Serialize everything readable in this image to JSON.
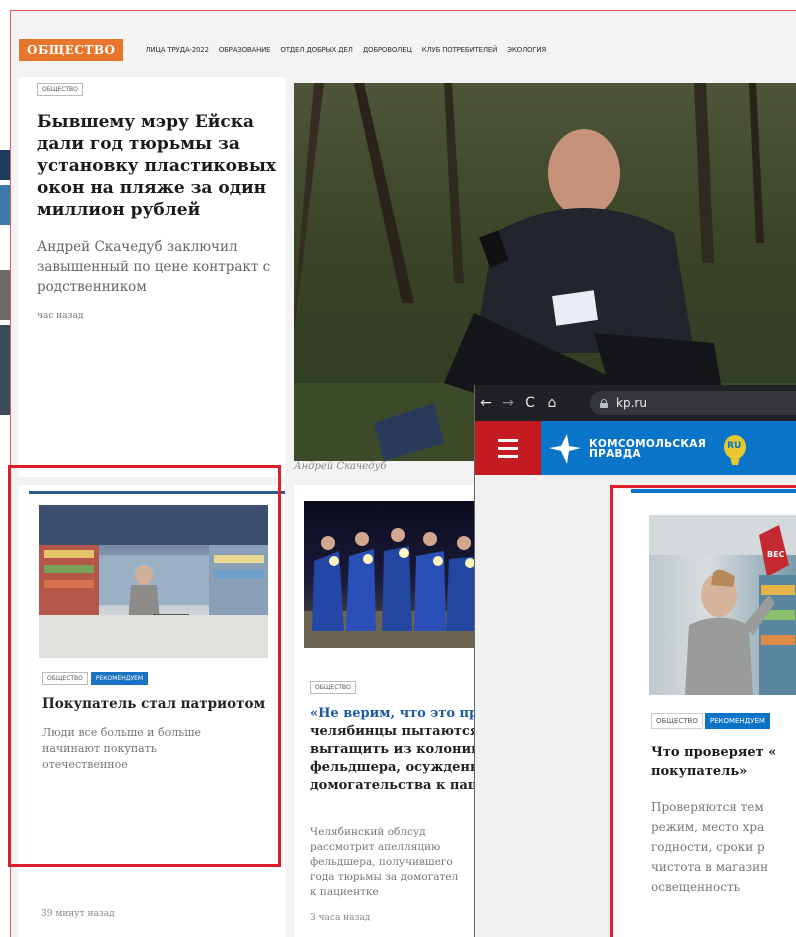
{
  "section": {
    "badge": "ОБЩЕСТВО",
    "tags": [
      "ЛИЦА ТРУДА-2022",
      "ОБРАЗОВАНИЕ",
      "ОТДЕЛ ДОБРЫХ ДЕЛ",
      "ДОБРОВОЛЕЦ",
      "КЛУБ ПОТРЕБИТЕЛЕЙ",
      "ЭКОЛОГИЯ"
    ]
  },
  "lead": {
    "tag": "ОБЩЕСТВО",
    "title": "Бывшему мэру Ейска дали год тюрьмы за установку пластиковых окон на пляже за один миллион рублей",
    "subtitle": "Андрей Скачедуб заключил завышенный по цене контракт с родственником",
    "time": "час назад",
    "photo_caption": "Андрей Скачедуб"
  },
  "card2": {
    "tags": [
      "ОБЩЕСТВО",
      "РЕКОМЕНДУЕМ"
    ],
    "title": "Покупатель стал патриотом",
    "subtitle": "Люди все больше и больше начинают покупать отечественное",
    "time": "39 минут назад"
  },
  "card3": {
    "tag": "ОБЩЕСТВО",
    "title_l1": "«Не верим, что это пра",
    "title_l2": "челябинцы пытаются",
    "title_l3": "вытащить из колонии",
    "title_l4": "фельдшера, осужденно",
    "title_l5": "домогательства к паци",
    "sub_l1": "Челябинский облсуд",
    "sub_l2": "рассмотрит апелляцию",
    "sub_l3": "фельдшера, получившего",
    "sub_l4": "года тюрьмы за домогател",
    "sub_l5": "к пациентке",
    "time": "3 часа назад"
  },
  "browser": {
    "back": "←",
    "forward": "→",
    "reload": "C",
    "home": "⌂",
    "url": "kp.ru",
    "logo_line1": "КОМСОМОЛЬСКАЯ",
    "logo_line2": "ПРАВДА",
    "logo_badge": "RU"
  },
  "mobile_card": {
    "tags": [
      "ОБЩЕСТВО",
      "РЕКОМЕНДУЕМ"
    ],
    "shelf_sign": "ВЕС",
    "title_l1": "Что проверяет «",
    "title_l2": "покупатель»",
    "sub_l1": "Проверяются тем",
    "sub_l2": "режим, место хра",
    "sub_l3": "годности, сроки р",
    "sub_l4": "чистота в магазин",
    "sub_l5": "освещенность"
  },
  "colors": {
    "section_badge": "#e8762c",
    "highlight_box": "#e01e2a",
    "kp_blue": "#0a74c8",
    "kp_red": "#c41a22",
    "tag_blue": "#1a73c2"
  }
}
